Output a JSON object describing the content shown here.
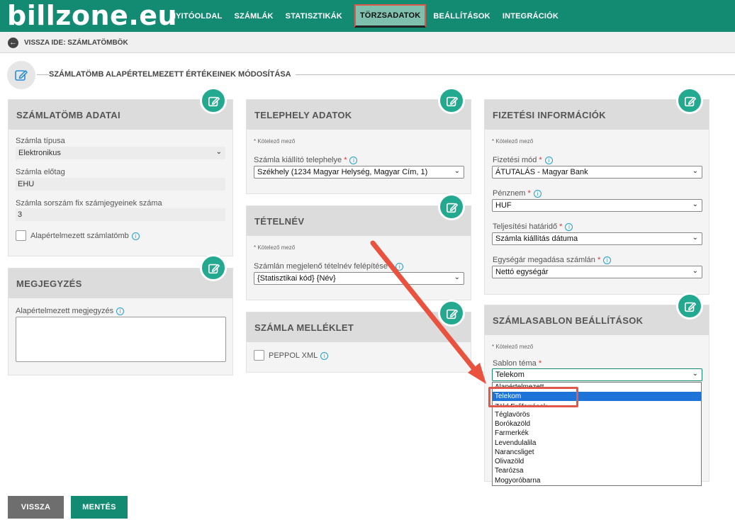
{
  "logo": "billzone.eu",
  "nav": {
    "items": [
      "NYITÓOLDAL",
      "SZÁMLÁK",
      "STATISZTIKÁK",
      "TÖRZSADATOK",
      "BEÁLLÍTÁSOK",
      "INTEGRÁCIÓK"
    ]
  },
  "breadcrumb": "VISSZA IDE: SZÁMLATÖMBÖK",
  "page_title": "SZÁMLATÖMB ALAPÉRTELMEZETT ÉRTÉKEINEK MÓDOSÍTÁSA",
  "required_note": "* Kötelező mező",
  "szamlatomb": {
    "title": "SZÁMLATÖMB ADATAI",
    "type_label": "Számla típusa",
    "type_value": "Elektronikus",
    "prefix_label": "Számla előtag",
    "prefix_value": "EHU",
    "digits_label": "Számla sorszám fix számjegyeinek száma",
    "digits_value": "3",
    "default_label": "Alapértelmezett számlatömb"
  },
  "megjegyzes": {
    "title": "MEGJEGYZÉS",
    "label": "Alapértelmezett megjegyzés"
  },
  "telephely": {
    "title": "TELEPHELY ADATOK",
    "label": "Számla kiállító telephelye",
    "value": "Székhely (1234 Magyar Helység, Magyar Cím, 1)"
  },
  "tetelnev": {
    "title": "TÉTELNÉV",
    "label": "Számlán megjelenő tételnév felépítése",
    "value": "{Statisztikai kód} {Név}"
  },
  "melleklet": {
    "title": "SZÁMLA MELLÉKLET",
    "peppol_label": "PEPPOL XML"
  },
  "fizetes": {
    "title": "FIZETÉSI INFORMÁCIÓK",
    "mode_label": "Fizetési mód",
    "mode_value": "ÁTUTALÁS - Magyar Bank",
    "currency_label": "Pénznem",
    "currency_value": "HUF",
    "deadline_label": "Teljesítési határidő",
    "deadline_value": "Számla kiállítás dátuma",
    "unitprice_label": "Egységár megadása számlán",
    "unitprice_value": "Nettó egységár"
  },
  "sablon": {
    "title": "SZÁMLASABLON BEÁLLÍTÁSOK",
    "theme_label": "Sablon téma",
    "theme_value": "Telekom",
    "options": [
      "Alapértelmezett",
      "Telekom",
      "Zöld Erőforrások",
      "Téglavörös",
      "Borókazöld",
      "Farmerkék",
      "Levendulalila",
      "Narancsliget",
      "Olivazöld",
      "Tearózsa",
      "Mogyoróbarna"
    ]
  },
  "buttons": {
    "back": "VISSZA",
    "save": "MENTÉS"
  },
  "colors": {
    "brand": "#138a72",
    "accent": "#23a98f",
    "highlight": "#e0584a",
    "selection": "#1e73d8"
  }
}
